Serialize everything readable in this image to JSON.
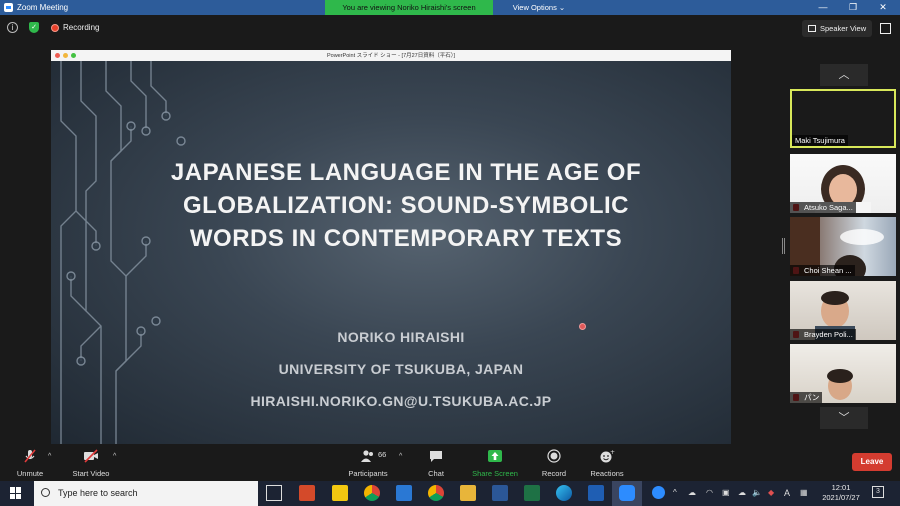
{
  "window": {
    "title": "Zoom Meeting",
    "share_banner": "You are viewing Noriko Hiraishi's screen",
    "view_options": "View Options",
    "recording_label": "Recording",
    "speaker_view_label": "Speaker View"
  },
  "shared_window": {
    "title": "PowerPoint スライド ショー - [7月27日資料（平石）]"
  },
  "slide": {
    "title": "Japanese Language in the Age of Globalization: Sound-Symbolic Words in Contemporary Texts",
    "author": "NORIKO HIRAISHI",
    "affiliation": "UNIVERSITY OF TSUKUBA, JAPAN",
    "email": "HIRAISHI.NORIKO.GN@U.TSUKUBA.AC.JP"
  },
  "gallery": {
    "participants": [
      {
        "name": "Maki Tsujimura",
        "muted": false,
        "active": true
      },
      {
        "name": "Atsuko Saga...",
        "muted": true,
        "active": false
      },
      {
        "name": "Choi Shean ...",
        "muted": true,
        "active": false
      },
      {
        "name": "Brayden Poli...",
        "muted": true,
        "active": false
      },
      {
        "name": "パン",
        "muted": true,
        "active": false
      }
    ]
  },
  "controls": {
    "unmute": "Unmute",
    "start_video": "Start Video",
    "participants": "Participants",
    "participant_count": "66",
    "chat": "Chat",
    "share_screen": "Share Screen",
    "record": "Record",
    "reactions": "Reactions",
    "leave": "Leave"
  },
  "taskbar": {
    "search_placeholder": "Type here to search",
    "time": "12:01",
    "date": "2021/07/27",
    "input_indicator": "A",
    "notification_count": "3"
  },
  "colors": {
    "share_banner": "#2fb84b",
    "active_speaker_border": "#d8e85a",
    "leave": "#d43c30",
    "share_screen": "#2fb84b"
  }
}
